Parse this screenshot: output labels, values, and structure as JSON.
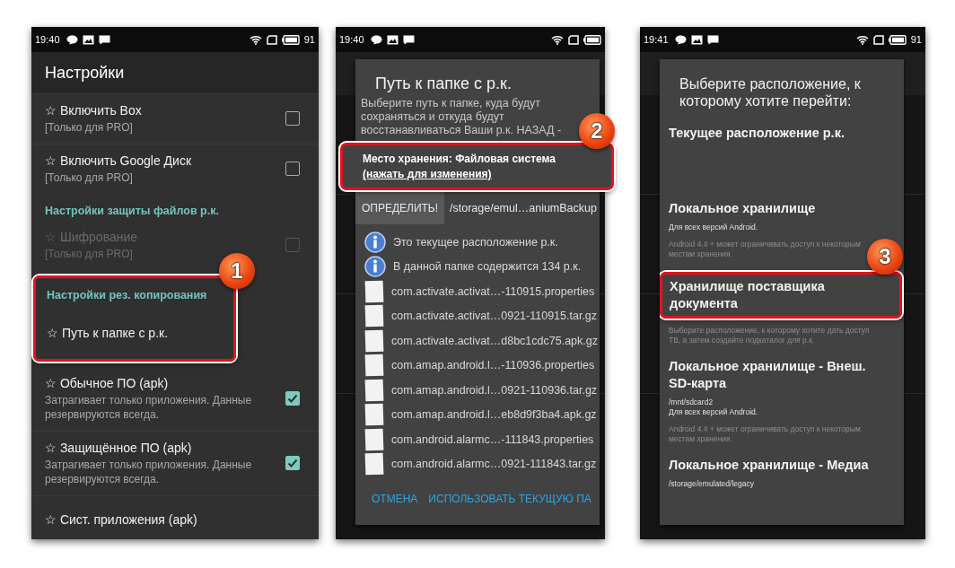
{
  "phones": [
    {
      "kind": "settings",
      "status": {
        "time": "19:40",
        "battery": "91"
      },
      "title": "Настройки",
      "items": [
        {
          "kind": "setting",
          "title": "☆ Включить Box",
          "subtitle": "[Только для PRO]",
          "checked": false,
          "disabled": false
        },
        {
          "kind": "setting",
          "title": "☆ Включить Google Диск",
          "subtitle": "[Только для PRO]",
          "checked": false,
          "disabled": false
        },
        {
          "kind": "header",
          "title": "Настройки защиты файлов р.к."
        },
        {
          "kind": "setting",
          "title": "☆ Шифрование",
          "subtitle": "[Только для PRO]",
          "checked": false,
          "disabled": true
        },
        {
          "kind": "highlight",
          "callout": "1",
          "items": [
            {
              "kind": "header",
              "title": "Настройки рез. копирования"
            },
            {
              "kind": "setting",
              "title": "☆ Путь к папке с р.к.",
              "disabled": false
            }
          ]
        },
        {
          "kind": "setting",
          "title": "☆ Обычное ПО (apk)",
          "subtitle": "Затрагивает только приложения. Данные резервируются всегда.",
          "checked": true,
          "disabled": false
        },
        {
          "kind": "setting",
          "title": "☆ Защищённое ПО (apk)",
          "subtitle": "Затрагивает только приложения. Данные резервируются всегда.",
          "checked": true,
          "disabled": false
        },
        {
          "kind": "setting",
          "title": "☆ Сист. приложения (apk)",
          "disabled": false
        }
      ]
    },
    {
      "kind": "folder_dialog",
      "status": {
        "time": "19:40"
      },
      "dialog": {
        "title": "Путь к папке с р.к.",
        "message": "Выберите путь к папке, куда будут сохраняться и откуда будут восстанавливаться Ваши р.к. НАЗАД -",
        "storage": {
          "label": "Место хранения: Файловая система",
          "link": "(нажать для изменения)",
          "highlighted": true,
          "callout": "2"
        },
        "detect_button": "ОПРЕДЕЛИТЬ!",
        "path": "/storage/emul…aniumBackup",
        "info": [
          "Это текущее расположение р.к.",
          "В данной папке содержится 134 р.к."
        ],
        "files": [
          "com.activate.activat…-110915.properties",
          "com.activate.activat…0921-110915.tar.gz",
          "com.activate.activat…d8bc1cdc75.apk.gz",
          "com.amap.android.l…-110936.properties",
          "com.amap.android.l…0921-110936.tar.gz",
          "com.amap.android.l…eb8d9f3ba4.apk.gz",
          "com.android.alarmc…-111843.properties",
          "com.android.alarmc…0921-111843.tar.gz"
        ],
        "buttons": [
          "ОТМЕНА",
          "ИСПОЛЬЗОВАТЬ ТЕКУЩУЮ ПА"
        ]
      }
    },
    {
      "kind": "location_dialog",
      "status": {
        "time": "19:41",
        "battery": "91"
      },
      "dialog": {
        "title": "Выберите расположение, к которому хотите перейти:",
        "options": [
          {
            "title": "Текущее расположение р.к.",
            "highlighted": false
          },
          {
            "title": "Локальное хранилище",
            "details": [
              "Для всех версий Android."
            ],
            "note": "Android 4.4 + может ограничивать доступ к некоторым местам хранения.",
            "highlighted": false
          },
          {
            "title": "Хранилище поставщика документа",
            "note": "Выберите расположение, к которому хотите дать доступ TB, а затем создайте подкаталог для р.к.",
            "highlighted": true,
            "callout": "3"
          },
          {
            "title": "Локальное хранилище - Внеш. SD-карта",
            "details": [
              "/mnt/sdcard2",
              "Для всех версий Android."
            ],
            "note": "Android 4.4 + может ограничивать доступ к некоторым местам хранения.",
            "highlighted": false
          },
          {
            "title": "Локальное хранилище - Медиа",
            "details": [
              "/storage/emulated/legacy"
            ],
            "highlighted": false
          }
        ]
      }
    }
  ]
}
